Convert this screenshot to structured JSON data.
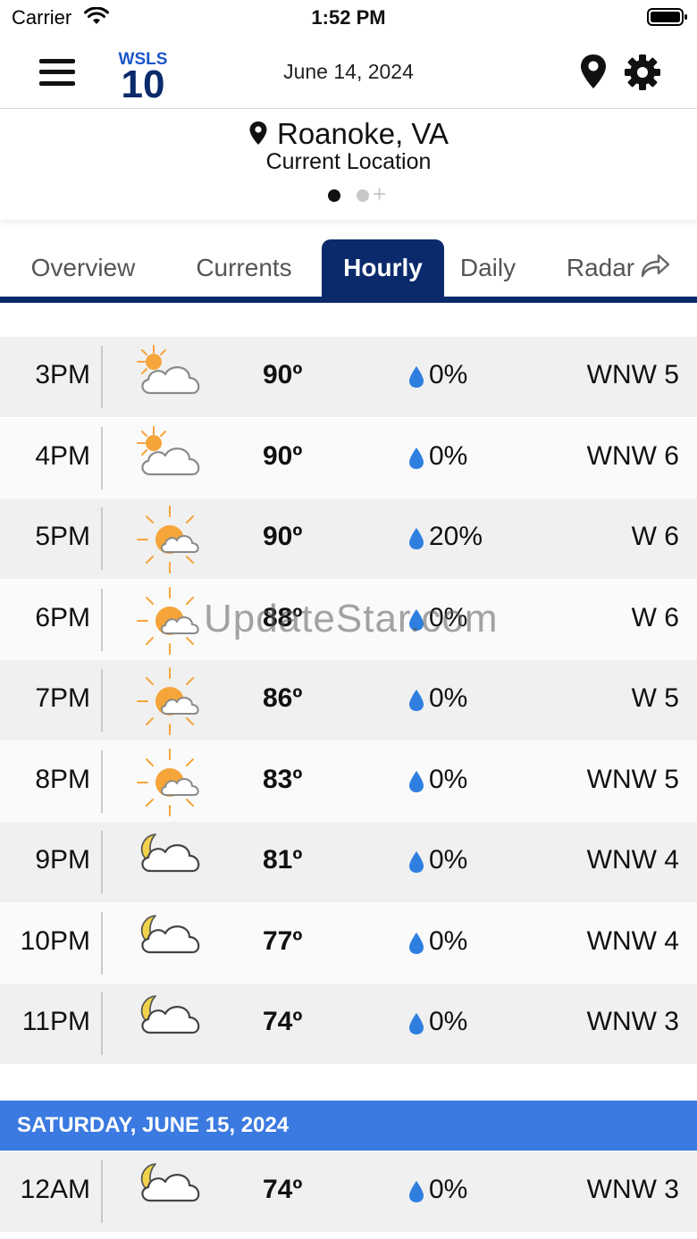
{
  "status_bar": {
    "carrier": "Carrier",
    "time": "1:52 PM"
  },
  "header": {
    "date": "June 14, 2024",
    "logo_top": "WSLS",
    "logo_bottom": "10"
  },
  "location": {
    "name": "Roanoke, VA",
    "subtitle": "Current Location",
    "page_add": "+"
  },
  "tabs": [
    {
      "label": "Overview"
    },
    {
      "label": "Currents"
    },
    {
      "label": "Hourly",
      "active": true
    },
    {
      "label": "Daily"
    },
    {
      "label": "Radar"
    }
  ],
  "hourly": [
    {
      "time": "3PM",
      "icon": "partly-cloudy-day-icon",
      "temp": "90º",
      "precip": "0%",
      "wind": "WNW 5"
    },
    {
      "time": "4PM",
      "icon": "partly-cloudy-day-icon",
      "temp": "90º",
      "precip": "0%",
      "wind": "WNW 6"
    },
    {
      "time": "5PM",
      "icon": "mostly-sunny-icon",
      "temp": "90º",
      "precip": "20%",
      "wind": "W 6"
    },
    {
      "time": "6PM",
      "icon": "mostly-sunny-icon",
      "temp": "88º",
      "precip": "0%",
      "wind": "W 6"
    },
    {
      "time": "7PM",
      "icon": "mostly-sunny-icon",
      "temp": "86º",
      "precip": "0%",
      "wind": "W 5"
    },
    {
      "time": "8PM",
      "icon": "mostly-sunny-icon",
      "temp": "83º",
      "precip": "0%",
      "wind": "WNW 5"
    },
    {
      "time": "9PM",
      "icon": "partly-cloudy-night-icon",
      "temp": "81º",
      "precip": "0%",
      "wind": "WNW 4"
    },
    {
      "time": "10PM",
      "icon": "partly-cloudy-night-icon",
      "temp": "77º",
      "precip": "0%",
      "wind": "WNW 4"
    },
    {
      "time": "11PM",
      "icon": "partly-cloudy-night-icon",
      "temp": "74º",
      "precip": "0%",
      "wind": "WNW 3"
    }
  ],
  "next_day": {
    "header": "SATURDAY, JUNE 15, 2024",
    "rows": [
      {
        "time": "12AM",
        "icon": "partly-cloudy-night-icon",
        "temp": "74º",
        "precip": "0%",
        "wind": "WNW 3"
      }
    ]
  },
  "watermark": "UpdateStar.com",
  "colors": {
    "nav_blue": "#0a2a6b",
    "day_header_blue": "#3b7ae0",
    "drop_blue": "#2f7fe0",
    "sun_orange": "#f5a53a"
  }
}
